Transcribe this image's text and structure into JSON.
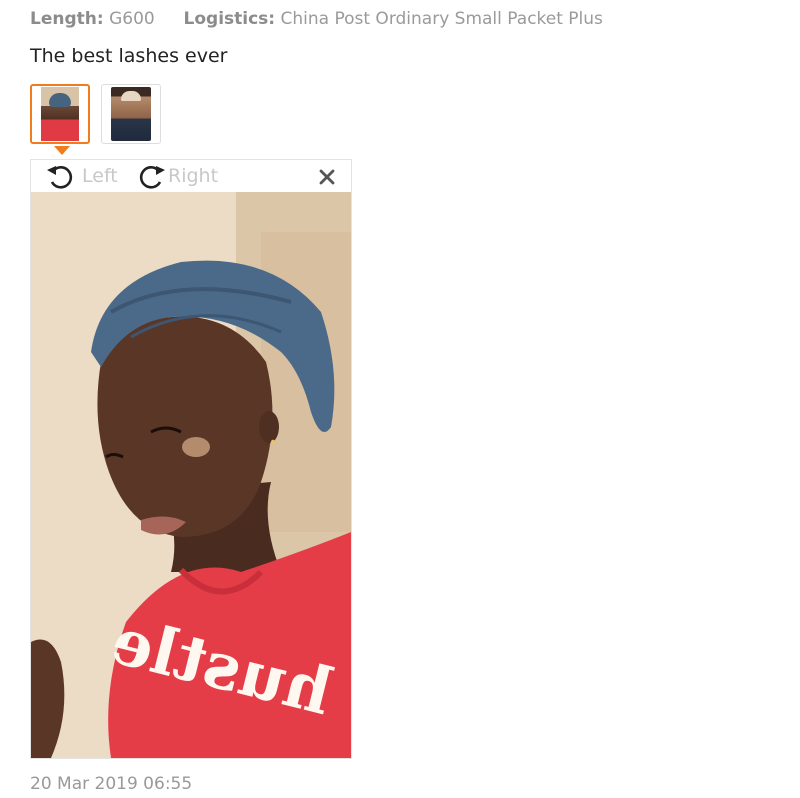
{
  "review": {
    "attributes": [
      {
        "key": "Length:",
        "value": "G600"
      },
      {
        "key": "Logistics:",
        "value": "China Post Ordinary Small Packet Plus"
      }
    ],
    "text": "The best lashes ever",
    "thumbnails": [
      {
        "alt": "review photo 1",
        "selected": true
      },
      {
        "alt": "review photo 2",
        "selected": false
      }
    ],
    "date": "20 Mar 2019 06:55"
  },
  "viewer": {
    "rotate_left_label": "Left",
    "rotate_right_label": "Right",
    "close_icon": "close-icon",
    "photo_text": "hustle"
  },
  "colors": {
    "accent": "#f07c1e",
    "muted_text": "#999999",
    "shirt": "#e43d48",
    "headwrap": "#4b6a8a"
  }
}
